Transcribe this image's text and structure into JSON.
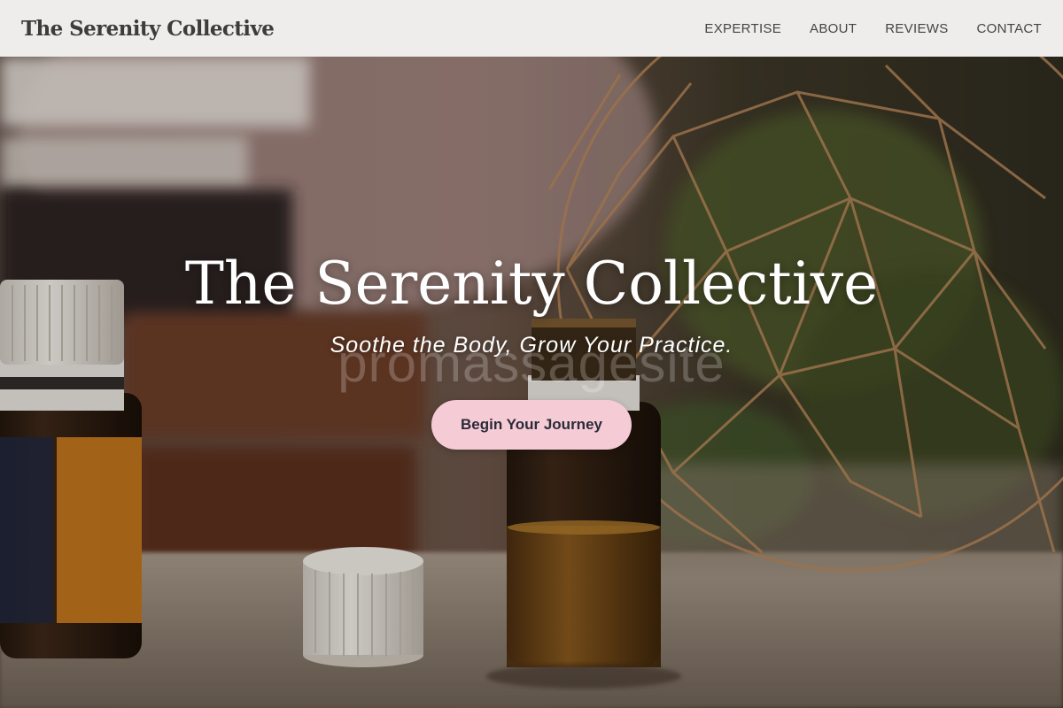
{
  "header": {
    "brand": "The Serenity Collective",
    "nav": [
      {
        "label": "EXPERTISE"
      },
      {
        "label": "ABOUT"
      },
      {
        "label": "REVIEWS"
      },
      {
        "label": "CONTACT"
      }
    ]
  },
  "hero": {
    "title": "The Serenity Collective",
    "tagline": "Soothe the Body, Grow Your Practice.",
    "watermark": "promassagesite",
    "cta_label": "Begin Your Journey"
  },
  "colors": {
    "header_bg": "#f7f6f4",
    "cta_bg": "#f5cbd6",
    "cta_text": "#2b2b38",
    "hero_text": "#ffffff"
  }
}
